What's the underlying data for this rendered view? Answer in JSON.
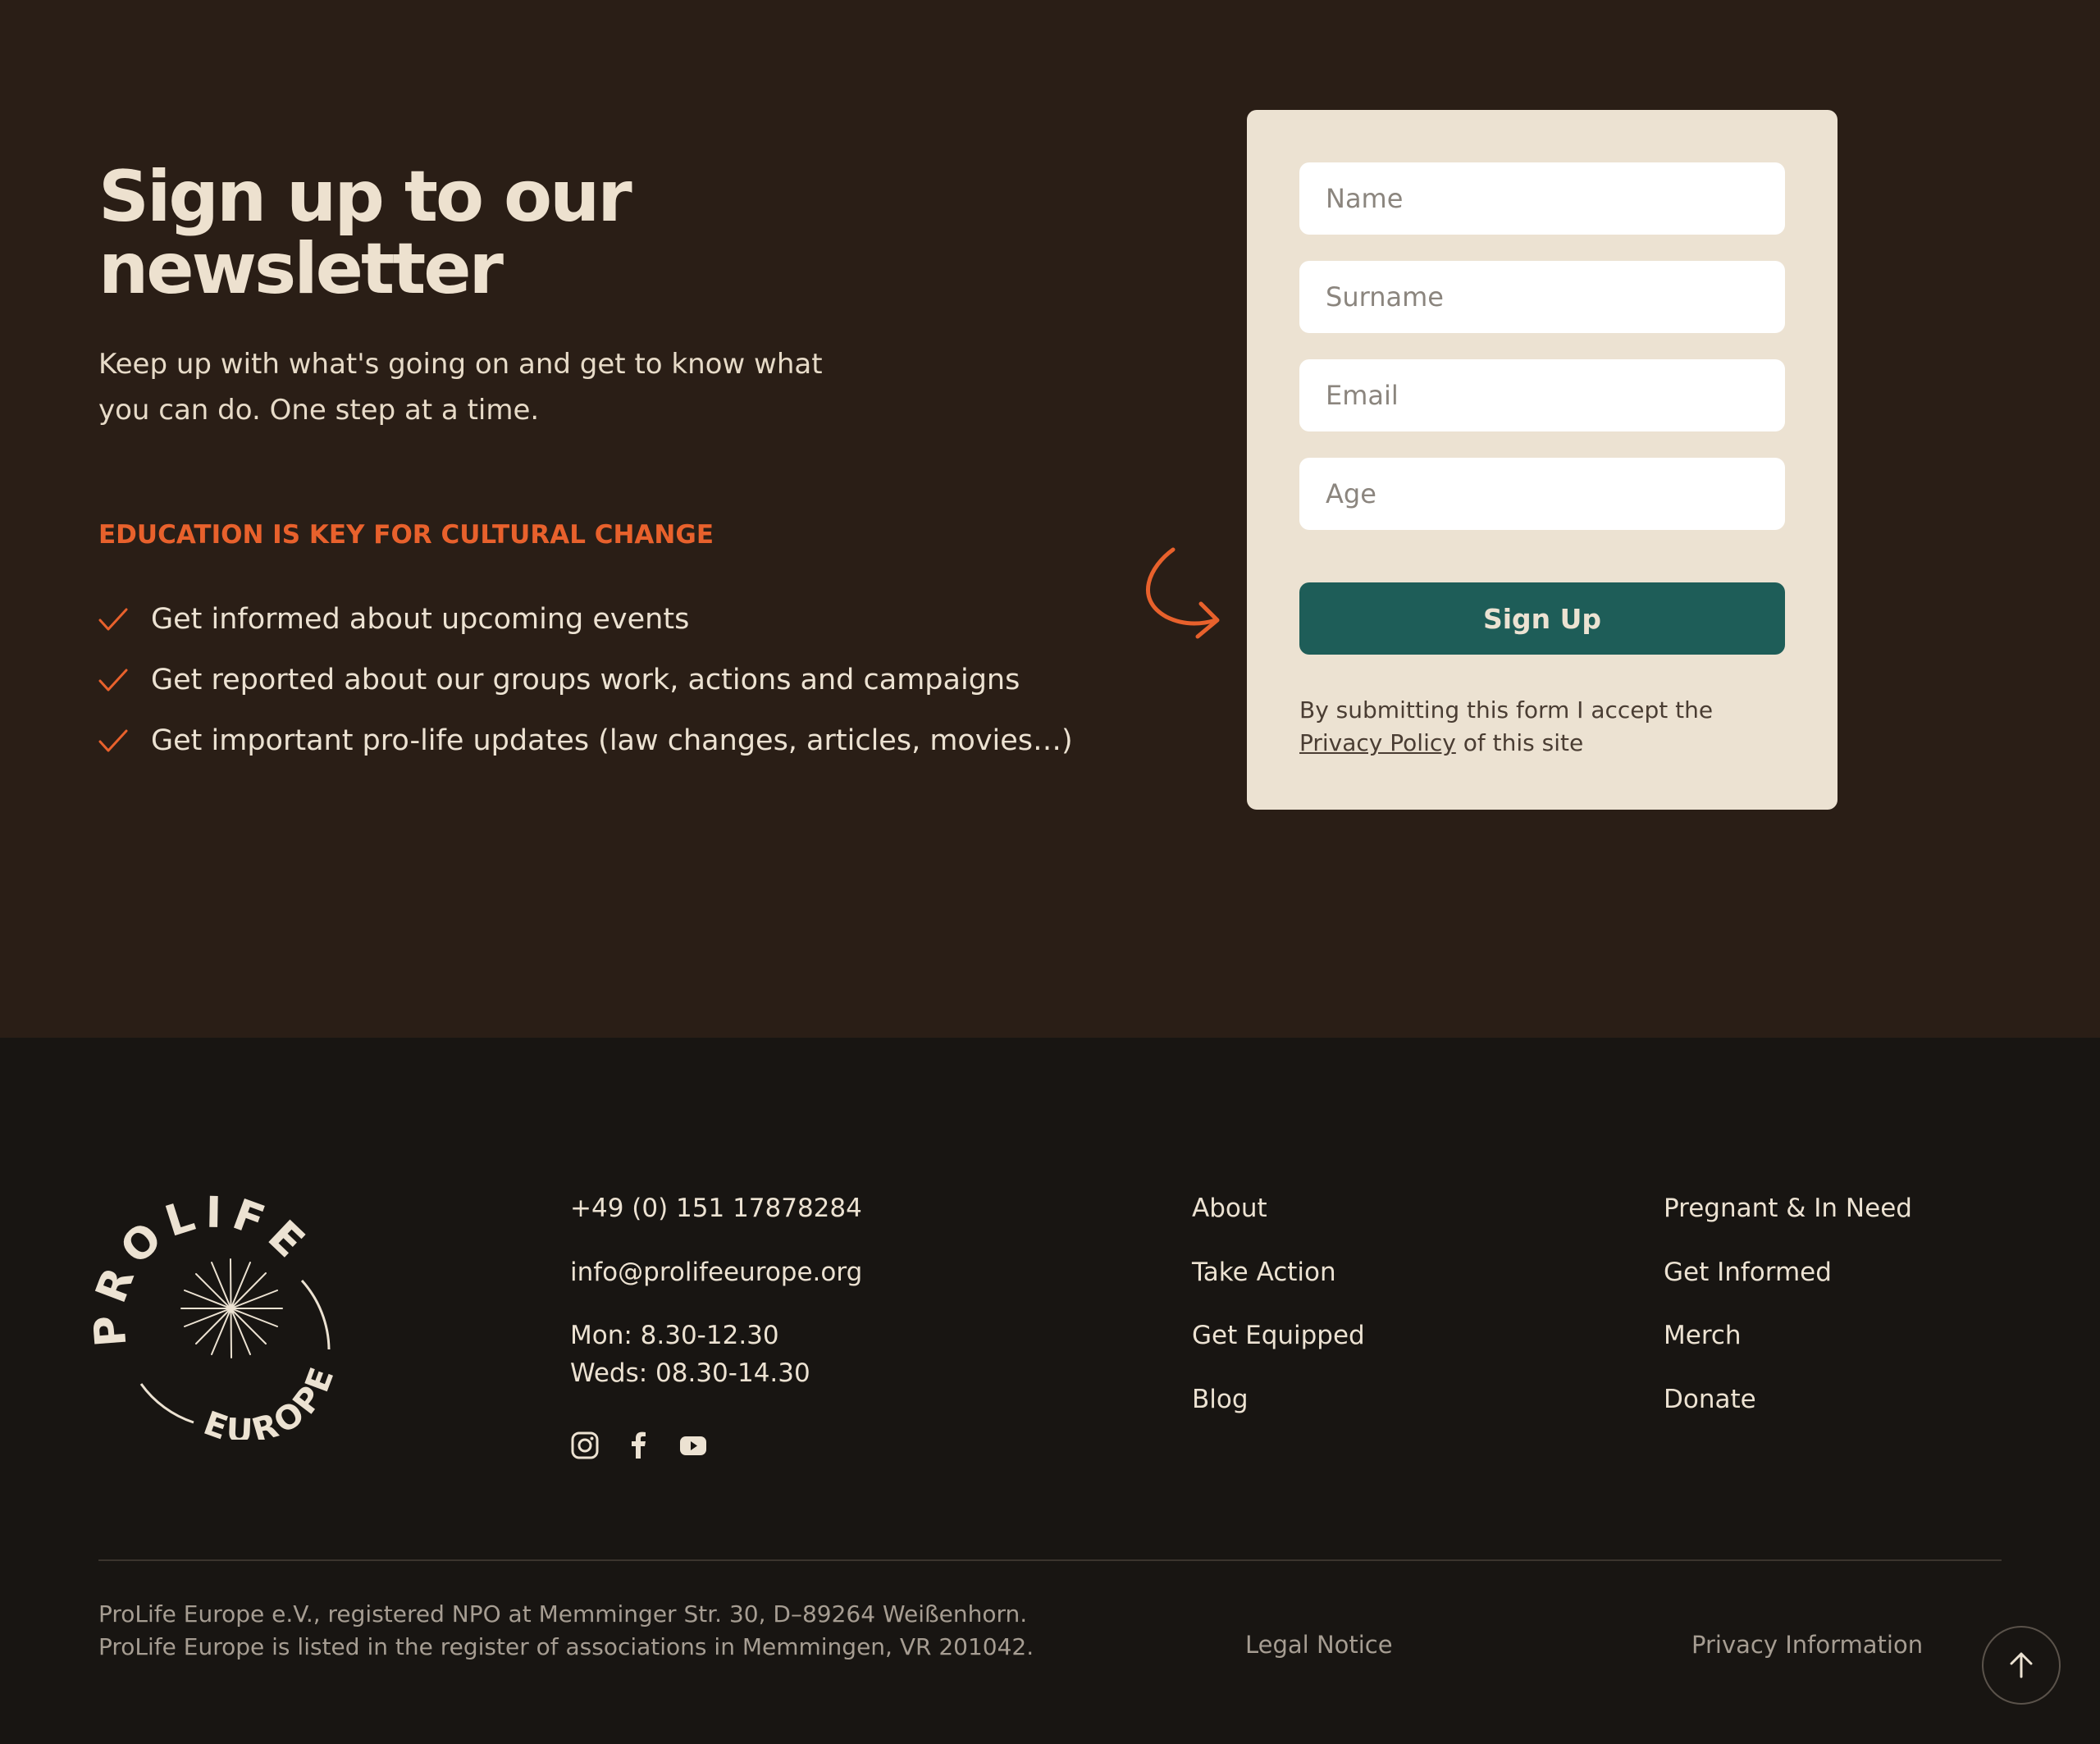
{
  "newsletter": {
    "title_line1": "Sign up to our",
    "title_line2": "newsletter",
    "desc_line1": "Keep up with what's going on and get to know what",
    "desc_line2": "you can do. One step at a time.",
    "kicker": "EDUCATION IS KEY FOR CULTURAL CHANGE",
    "benefits": [
      "Get informed about upcoming events",
      "Get reported about our groups work, actions and campaigns",
      "Get important pro-life updates (law changes, articles, movies…)"
    ]
  },
  "form": {
    "name_placeholder": "Name",
    "surname_placeholder": "Surname",
    "email_placeholder": "Email",
    "age_placeholder": "Age",
    "submit_label": "Sign Up",
    "consent_prefix": "By submitting this form I accept the ",
    "consent_link": "Privacy Policy",
    "consent_suffix": " of this site"
  },
  "footer": {
    "logo_text_top": "PROLIFE",
    "logo_text_bottom": "EUROPE",
    "phone": "+49 (0) 151 17878284",
    "email": "info@prolifeeurope.org",
    "hours_mon": "Mon: 8.30-12.30",
    "hours_wed": "Weds: 08.30-14.30",
    "socials": [
      "instagram-icon",
      "facebook-icon",
      "youtube-icon"
    ],
    "nav_col1": [
      "About",
      "Take Action",
      "Get Equipped",
      "Blog"
    ],
    "nav_col2": [
      "Pregnant & In Need",
      "Get Informed",
      "Merch",
      "Donate"
    ],
    "legal_line1": "ProLife Europe e.V., registered NPO at Memminger Str. 30, D–89264  Weißenhorn.",
    "legal_line2": "ProLife Europe is listed in the register of associations in Memmingen, VR 201042.",
    "legal_notice": "Legal Notice",
    "privacy_info": "Privacy Information"
  },
  "colors": {
    "newsletter_bg": "#2a1e16",
    "footer_bg": "#181512",
    "accent": "#e8612c",
    "button": "#1e5d58",
    "card": "#ece2d2"
  }
}
